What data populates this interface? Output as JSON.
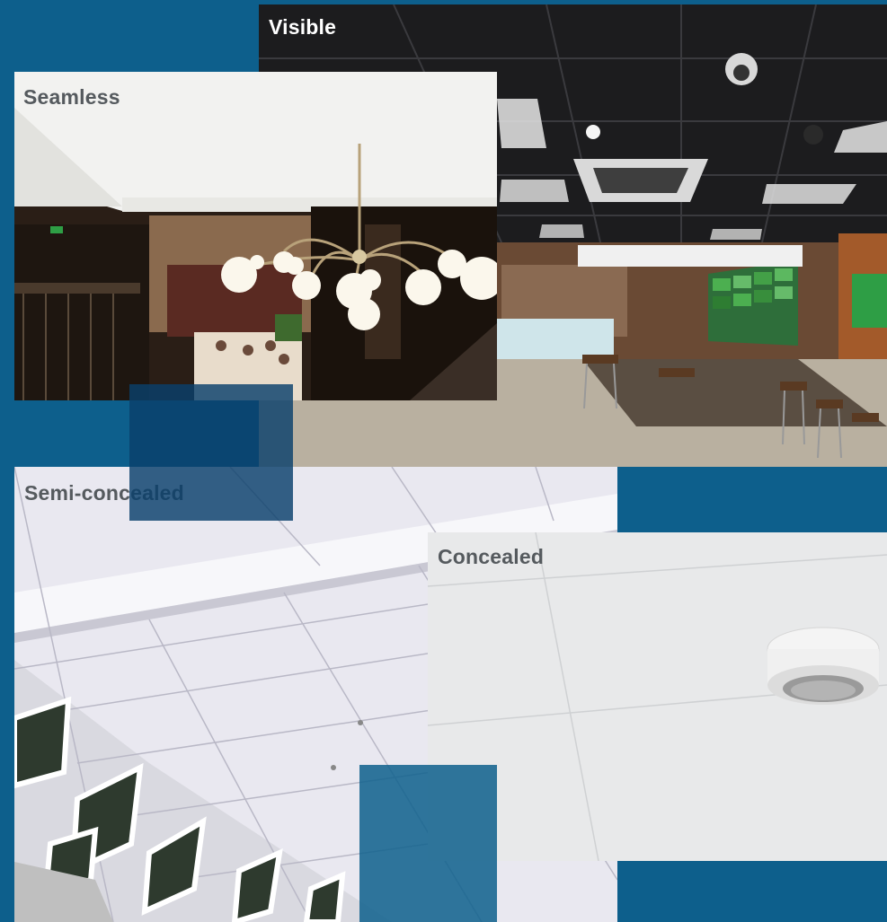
{
  "labels": {
    "visible": "Visible",
    "seamless": "Seamless",
    "semi_concealed": "Semi-concealed",
    "concealed": "Concealed"
  },
  "colors": {
    "background": "#0d5f8c",
    "overlay_block": "#0a3f6b",
    "overlay_block_light": "#0d5f8c"
  }
}
